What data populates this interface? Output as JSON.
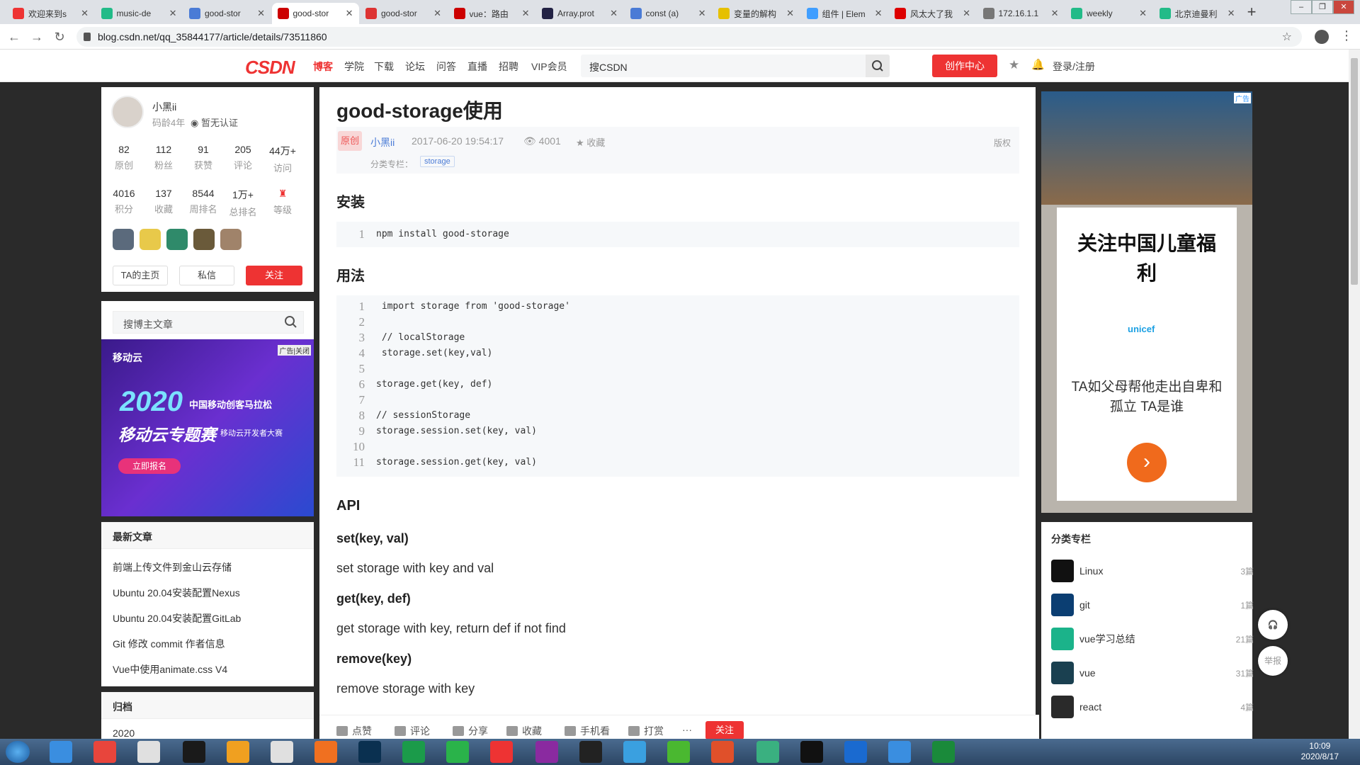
{
  "browser": {
    "tabs": [
      {
        "title": "欢迎来到s",
        "color": "#e33"
      },
      {
        "title": "music-de",
        "color": "#2b8"
      },
      {
        "title": "good-stor",
        "color": "#4a7bd6"
      },
      {
        "title": "good-stor",
        "color": "#c00"
      },
      {
        "title": "good-stor",
        "color": "#d33"
      },
      {
        "title": "vue：路由",
        "color": "#c00"
      },
      {
        "title": "Array.prot",
        "color": "#224"
      },
      {
        "title": "const (a)",
        "color": "#4a7bd6"
      },
      {
        "title": "变量的解构",
        "color": "#e6c000"
      },
      {
        "title": "组件 | Elem",
        "color": "#409eff"
      },
      {
        "title": "风太大了我",
        "color": "#d00"
      },
      {
        "title": "172.16.1.1",
        "color": "#777"
      },
      {
        "title": "weekly",
        "color": "#2b8"
      },
      {
        "title": "北京迪曼利",
        "color": "#2b8"
      }
    ],
    "url": "blog.csdn.net/qq_35844177/article/details/73511860"
  },
  "csdn_nav": {
    "logo": "CSDN",
    "items": [
      "博客",
      "学院",
      "下载",
      "论坛",
      "问答",
      "直播",
      "招聘",
      "VIP会员"
    ],
    "search_placeholder": "搜CSDN",
    "create_label": "创作中心",
    "login_label": "登录/注册"
  },
  "profile": {
    "name": "小黑ii",
    "sub": "码龄4年",
    "cert": "暂无认证",
    "stats1": [
      {
        "n": "82",
        "l": "原创"
      },
      {
        "n": "112",
        "l": "粉丝"
      },
      {
        "n": "91",
        "l": "获赞"
      },
      {
        "n": "205",
        "l": "评论"
      },
      {
        "n": "44万+",
        "l": "访问"
      }
    ],
    "stats2": [
      {
        "n": "4016",
        "l": "积分"
      },
      {
        "n": "137",
        "l": "收藏"
      },
      {
        "n": "8544",
        "l": "周排名"
      },
      {
        "n": "1万+",
        "l": "总排名"
      },
      {
        "n": "",
        "l": "等级"
      }
    ],
    "btn_home": "TA的主页",
    "btn_msg": "私信",
    "btn_follow": "关注"
  },
  "left_search": {
    "placeholder": "搜博主文章"
  },
  "left_ad": {
    "brand": "移动云",
    "ad_tag": "广告",
    "close_label": "关闭",
    "year": "2020",
    "line1": "中国移动创客马拉松",
    "line2": "移动云专题赛",
    "line3": "移动云开发者大赛",
    "cta": "立即报名"
  },
  "recent": {
    "title": "最新文章",
    "items": [
      "前端上传文件到金山云存储",
      "Ubuntu 20.04安装配置Nexus",
      "Ubuntu 20.04安装配置GitLab",
      "Git 修改 commit 作者信息",
      "Vue中使用animate.css V4"
    ]
  },
  "archive": {
    "title": "归档",
    "first": "2020"
  },
  "article": {
    "title": "good-storage使用",
    "tag": "原创",
    "author": "小黑ii",
    "date": "2017-06-20 19:54:17",
    "views": "4001",
    "fav": "收藏",
    "copyright": "版权",
    "cat_label": "分类专栏：",
    "cat": "storage",
    "h_install": "安装",
    "h_usage": "用法",
    "h_api": "API",
    "install_code": [
      "npm install good-storage"
    ],
    "usage_code": [
      " import storage from 'good-storage'",
      "",
      " // localStorage",
      " storage.set(key,val)",
      "",
      "storage.get(key, def)",
      "",
      "// sessionStorage",
      "storage.session.set(key, val)",
      "",
      "storage.session.get(key, val)"
    ],
    "api": [
      {
        "sig": "set(key, val)",
        "desc": "set storage with key and val"
      },
      {
        "sig": "get(key, def)",
        "desc": "get storage with key, return def if not find"
      },
      {
        "sig": "remove(key)",
        "desc": "remove storage with key"
      }
    ]
  },
  "bottom_bar": {
    "like": "点赞",
    "comment": "评论",
    "share": "分享",
    "collect": "收藏",
    "mobile": "手机看",
    "reward": "打赏",
    "more": "···",
    "follow": "关注"
  },
  "right_ad": {
    "title": "关注中国儿童福利",
    "brand": "unicef",
    "text": "TA如父母帮他走出自卑和孤立 TA是谁",
    "ad_tag": "广告"
  },
  "columns": {
    "title": "分类专栏",
    "items": [
      {
        "name": "Linux",
        "count": "3篇"
      },
      {
        "name": "git",
        "count": "1篇"
      },
      {
        "name": "vue学习总结",
        "count": "21篇"
      },
      {
        "name": "vue",
        "count": "31篇"
      },
      {
        "name": "react",
        "count": "4篇"
      }
    ]
  },
  "float": {
    "report": "举报"
  },
  "taskbar": {
    "time": "10:09",
    "date": "2020/8/17"
  }
}
